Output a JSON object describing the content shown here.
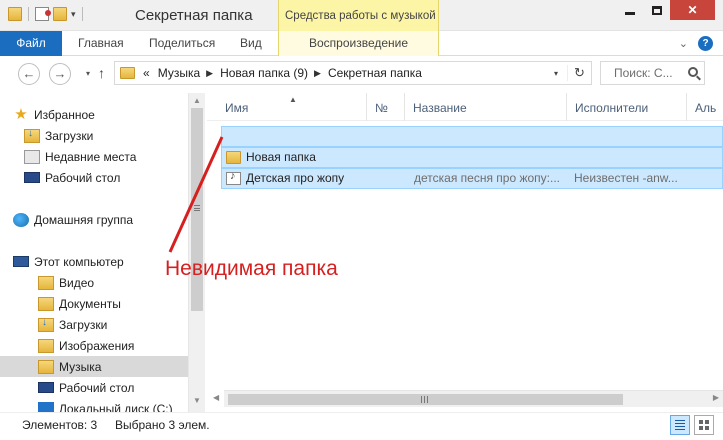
{
  "window": {
    "title": "Секретная папка",
    "context_tab_group": "Средства работы с музыкой",
    "close_glyph": "✕"
  },
  "ribbon": {
    "tabs": [
      {
        "label": "Файл"
      },
      {
        "label": "Главная"
      },
      {
        "label": "Поделиться"
      },
      {
        "label": "Вид"
      },
      {
        "label": "Воспроизведение"
      }
    ],
    "expand_glyph": "⌄",
    "help_glyph": "?"
  },
  "address": {
    "breadcrumbs": [
      "Музыка",
      "Новая папка (9)",
      "Секретная папка"
    ],
    "overflow_glyph": "«",
    "back_glyph": "←",
    "forward_glyph": "→",
    "up_glyph": "↑",
    "refresh_glyph": "↻"
  },
  "search": {
    "placeholder": "Поиск: С..."
  },
  "nav_pane": {
    "items": [
      {
        "label": "Избранное",
        "icon": "star-icon"
      },
      {
        "label": "Загрузки",
        "icon": "downloads-folder-icon"
      },
      {
        "label": "Недавние места",
        "icon": "recent-places-icon"
      },
      {
        "label": "Рабочий стол",
        "icon": "desktop-icon"
      },
      {
        "label": "Домашняя группа",
        "icon": "homegroup-icon"
      },
      {
        "label": "Этот компьютер",
        "icon": "computer-icon"
      },
      {
        "label": "Видео",
        "icon": "videos-folder-icon"
      },
      {
        "label": "Документы",
        "icon": "documents-folder-icon"
      },
      {
        "label": "Загрузки",
        "icon": "downloads-folder-icon"
      },
      {
        "label": "Изображения",
        "icon": "pictures-folder-icon"
      },
      {
        "label": "Музыка",
        "icon": "music-folder-icon",
        "selected": true
      },
      {
        "label": "Рабочий стол",
        "icon": "desktop-icon"
      },
      {
        "label": "Локальный диск (C:)",
        "icon": "drive-icon"
      }
    ]
  },
  "columns": [
    {
      "label": "Имя"
    },
    {
      "label": "№"
    },
    {
      "label": "Название"
    },
    {
      "label": "Исполнители"
    },
    {
      "label": "Аль"
    }
  ],
  "rows": [
    {
      "name": "",
      "number": "",
      "title": "",
      "artist": "",
      "icon": "invisible-folder"
    },
    {
      "name": "Новая папка",
      "number": "",
      "title": "",
      "artist": "",
      "icon": "folder-icon"
    },
    {
      "name": "Детская про жопу",
      "number": "",
      "title": "детская песня про жопу:...",
      "artist": "Неизвестен -anw...",
      "icon": "music-file-icon"
    }
  ],
  "status": {
    "items_count": "Элементов: 3",
    "selected_count": "Выбрано 3 элем."
  },
  "annotation": {
    "text": "Невидимая папка",
    "color": "#d62020"
  },
  "colors": {
    "file_tab": "#1a6dbf",
    "context_tab": "#fcf5a6",
    "selection": "#cce8ff",
    "close_button": "#c7453a"
  }
}
